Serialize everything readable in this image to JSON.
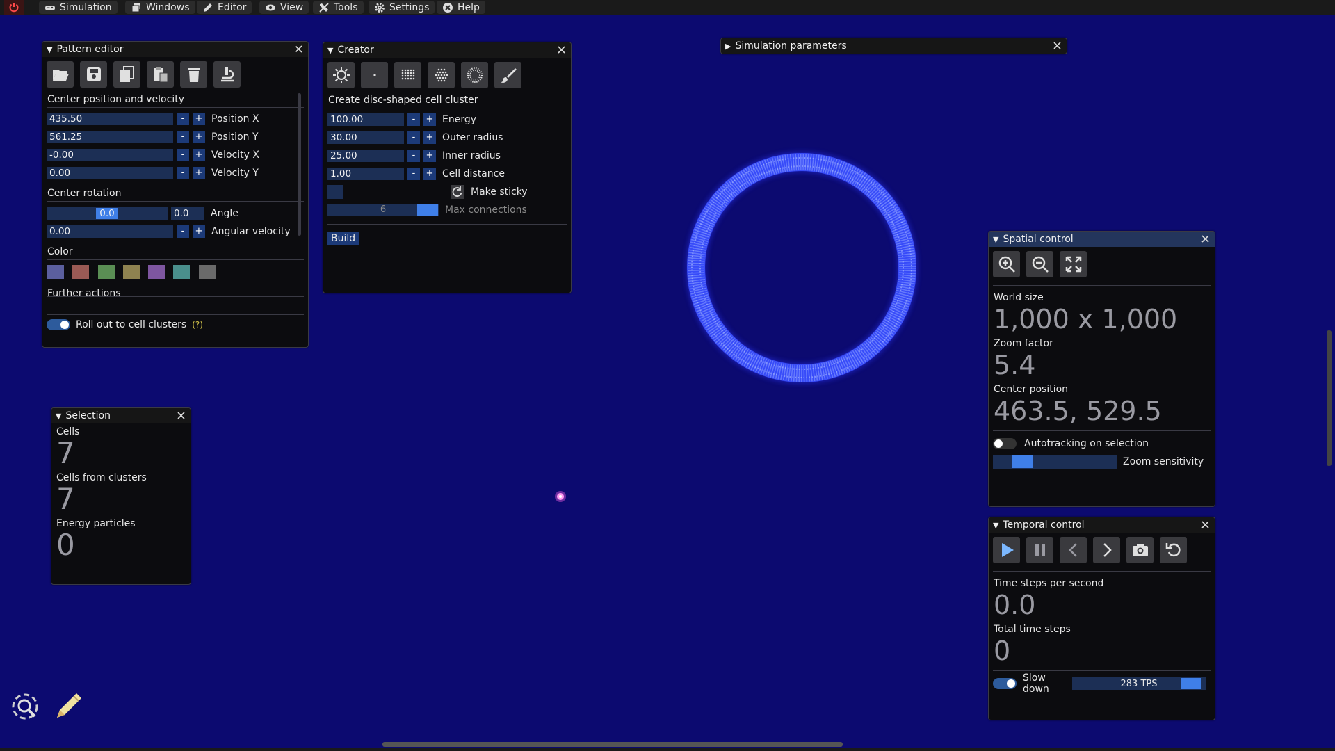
{
  "menu": {
    "items": [
      {
        "label": "Simulation",
        "icon": "gamepad-icon"
      },
      {
        "label": "Windows",
        "icon": "windows-icon"
      },
      {
        "label": "Editor",
        "icon": "pencil-icon"
      },
      {
        "label": "View",
        "icon": "eye-icon"
      },
      {
        "label": "Tools",
        "icon": "tools-icon"
      },
      {
        "label": "Settings",
        "icon": "gear-icon"
      },
      {
        "label": "Help",
        "icon": "help-icon"
      }
    ]
  },
  "pattern_editor": {
    "title": "Pattern editor",
    "section_center": "Center position and velocity",
    "position_x": {
      "value": "435.50",
      "label": "Position X"
    },
    "position_y": {
      "value": "561.25",
      "label": "Position Y"
    },
    "velocity_x": {
      "value": "-0.00",
      "label": "Velocity X"
    },
    "velocity_y": {
      "value": "0.00",
      "label": "Velocity Y"
    },
    "section_rotation": "Center rotation",
    "angle": {
      "slider_value": "0.0",
      "value": "0.0",
      "label": "Angle"
    },
    "angular_velocity": {
      "value": "0.00",
      "label": "Angular velocity"
    },
    "section_color": "Color",
    "colors": [
      "#5b5f9e",
      "#9a5a55",
      "#5a8e54",
      "#8e8250",
      "#7e56a0",
      "#4a8f8c",
      "#6a6a6a"
    ],
    "section_further": "Further actions",
    "rollout_label": "Roll out to cell clusters",
    "rollout_help": "(?)",
    "rollout_on": true
  },
  "creator": {
    "title": "Creator",
    "section": "Create disc-shaped cell cluster",
    "energy": {
      "value": "100.00",
      "label": "Energy"
    },
    "outer_radius": {
      "value": "30.00",
      "label": "Outer radius"
    },
    "inner_radius": {
      "value": "25.00",
      "label": "Inner radius"
    },
    "cell_distance": {
      "value": "1.00",
      "label": "Cell distance"
    },
    "make_sticky_label": "Make sticky",
    "max_connections": {
      "value": "6",
      "label": "Max connections"
    },
    "build_label": "Build"
  },
  "simulation_parameters": {
    "title": "Simulation parameters"
  },
  "spatial_control": {
    "title": "Spatial control",
    "world_size_label": "World size",
    "world_size": "1,000 x 1,000",
    "zoom_factor_label": "Zoom factor",
    "zoom_factor": "5.4",
    "center_position_label": "Center position",
    "center_position": "463.5, 529.5",
    "autotracking_label": "Autotracking on selection",
    "autotracking_on": false,
    "zoom_sensitivity_label": "Zoom sensitivity"
  },
  "temporal_control": {
    "title": "Temporal control",
    "tps_label": "Time steps per second",
    "tps": "0.0",
    "total_label": "Total time steps",
    "total": "0",
    "slow_down_label": "Slow down",
    "slow_down_on": true,
    "tps_slider": "283 TPS"
  },
  "selection": {
    "title": "Selection",
    "cells_label": "Cells",
    "cells": "7",
    "clusters_label": "Cells from clusters",
    "clusters": "7",
    "particles_label": "Energy particles",
    "particles": "0"
  },
  "colors": {
    "accent": "#1c3a78",
    "background": "#0c0a70",
    "ring": "#3b50ff"
  }
}
